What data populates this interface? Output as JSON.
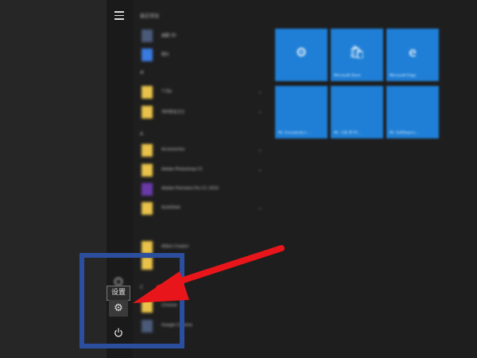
{
  "sidebar": {
    "menu_icon": "hamburger-icon",
    "user_icon": "user-icon",
    "settings_icon": "gear-icon",
    "power_icon": "power-icon",
    "settings_tooltip": "设置"
  },
  "app_list": {
    "recent_header": "最近添加",
    "sections": [
      {
        "header": "",
        "items": [
          {
            "label": "画图 3D",
            "icon": "paint-3d-icon"
          },
          {
            "label": "照片",
            "icon": "photos-icon"
          }
        ]
      },
      {
        "header": "#",
        "items": [
          {
            "label": "7-Zip",
            "icon": "folder-icon"
          },
          {
            "label": "360安全卫士",
            "icon": "folder-icon"
          }
        ]
      },
      {
        "header": "A",
        "items": [
          {
            "label": "Accessories",
            "icon": "folder-icon"
          },
          {
            "label": "Adobe Photoshop CC",
            "icon": "folder-icon"
          },
          {
            "label": "Adobe Premiere Pro CC 2015",
            "icon": "premiere-icon"
          },
          {
            "label": "AutoDesk",
            "icon": "folder-icon"
          }
        ]
      },
      {
        "header": "",
        "items": [
          {
            "label": "Alibre Creator",
            "icon": "folder-icon"
          }
        ]
      },
      {
        "header": "C",
        "items": [
          {
            "label": "Chrome",
            "icon": "folder-icon"
          },
          {
            "label": "Google Chrome",
            "icon": "chrome-icon"
          }
        ]
      }
    ]
  },
  "tiles": [
    {
      "icon": "gear-icon",
      "label": ""
    },
    {
      "icon": "store-icon",
      "label": "Microsoft Store"
    },
    {
      "icon": "edge-icon",
      "label": "Microsoft Edge"
    },
    {
      "icon": "",
      "label": "Mr. Everybody's ..."
    },
    {
      "icon": "",
      "label": "Mr. 人民 的 PC..."
    },
    {
      "icon": "",
      "label": "Mr. SoftDope's..."
    }
  ],
  "annotation": {
    "box_color": "#2b4f9e",
    "arrow_color": "#e8161b"
  },
  "colors": {
    "tile_blue": "#1f7fd6",
    "menu_bg": "#1e1e1e"
  }
}
